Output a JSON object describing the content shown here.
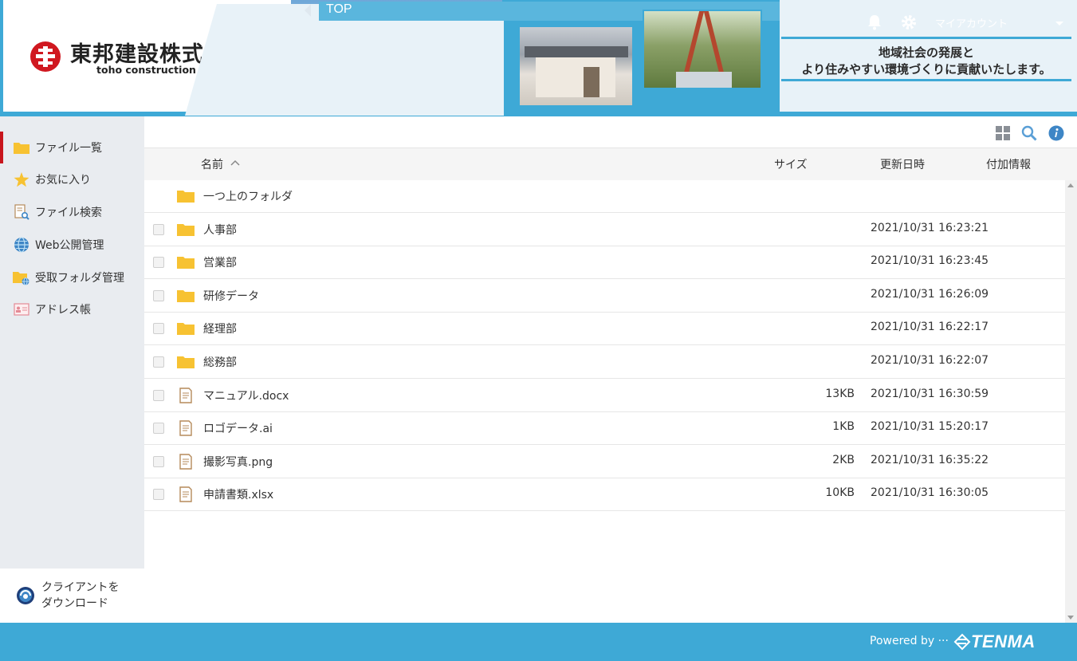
{
  "header": {
    "company_name_jp": "東邦建設株式會社",
    "company_name_en": "toho construction Co., Ltd.",
    "nav_label": "TOP",
    "account_label": "マイアカウント",
    "slogan_line1": "地域社会の発展と",
    "slogan_line2": "より住みやすい環境づくりに貢献いたします。",
    "accent_color": "#3ea9d6",
    "brand_red": "#d01820"
  },
  "sidebar": {
    "items": [
      {
        "label": "ファイル一覧",
        "icon": "folder-icon",
        "active": true
      },
      {
        "label": "お気に入り",
        "icon": "star-icon",
        "active": false
      },
      {
        "label": "ファイル検索",
        "icon": "file-search-icon",
        "active": false
      },
      {
        "label": "Web公開管理",
        "icon": "globe-icon",
        "active": false
      },
      {
        "label": "受取フォルダ管理",
        "icon": "folder-globe-icon",
        "active": false
      },
      {
        "label": "アドレス帳",
        "icon": "address-card-icon",
        "active": false
      }
    ],
    "client_download_line1": "クライアントを",
    "client_download_line2": "ダウンロード"
  },
  "toolbar": {
    "icons": [
      "grid-view-icon",
      "search-icon",
      "info-icon"
    ]
  },
  "table": {
    "columns": {
      "name": "名前",
      "size": "サイズ",
      "updated": "更新日時",
      "extra": "付加情報"
    },
    "sort": "name-ascending",
    "parent_folder_label": "一つ上のフォルダ",
    "rows": [
      {
        "name": "人事部",
        "type": "folder",
        "size": "",
        "updated": "2021/10/31 16:23:21"
      },
      {
        "name": "営業部",
        "type": "folder",
        "size": "",
        "updated": "2021/10/31 16:23:45"
      },
      {
        "name": "研修データ",
        "type": "folder",
        "size": "",
        "updated": "2021/10/31 16:26:09"
      },
      {
        "name": "経理部",
        "type": "folder",
        "size": "",
        "updated": "2021/10/31 16:22:17"
      },
      {
        "name": "総務部",
        "type": "folder",
        "size": "",
        "updated": "2021/10/31 16:22:07"
      },
      {
        "name": "マニュアル.docx",
        "type": "file",
        "size": "13KB",
        "updated": "2021/10/31 16:30:59"
      },
      {
        "name": "ロゴデータ.ai",
        "type": "file",
        "size": "1KB",
        "updated": "2021/10/31 15:20:17"
      },
      {
        "name": "撮影写真.png",
        "type": "file",
        "size": "2KB",
        "updated": "2021/10/31 16:35:22"
      },
      {
        "name": "申請書類.xlsx",
        "type": "file",
        "size": "10KB",
        "updated": "2021/10/31 16:30:05"
      }
    ]
  },
  "footer": {
    "powered_by": "Powered by ···",
    "brand": "TENMA"
  }
}
